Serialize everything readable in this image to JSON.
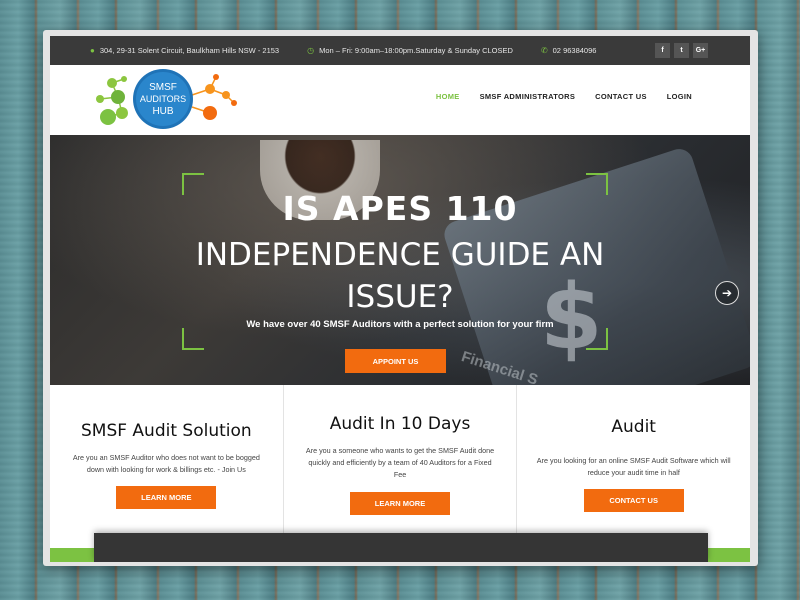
{
  "topbar": {
    "address": "304, 29-31 Solent Circuit, Baulkham Hills NSW - 2153",
    "hours": "Mon – Fri: 9:00am–18:00pm.Saturday & Sunday CLOSED",
    "phone": "02 96384096",
    "social": [
      "f",
      "t",
      "G+"
    ]
  },
  "logo": {
    "line1": "SMSF",
    "line2": "AUDITORS",
    "line3": "HUB"
  },
  "nav": {
    "items": [
      "HOME",
      "SMSF ADMINISTRATORS",
      "CONTACT US",
      "LOGIN"
    ]
  },
  "hero": {
    "title_line1": "IS APES 110",
    "title_line2": "INDEPENDENCE GUIDE AN",
    "title_line3": "ISSUE?",
    "subtitle": "We have over 40 SMSF Auditors with a perfect solution for your firm",
    "button": "APPOINT US",
    "bg_word": "Financial S",
    "bg_symbol": "$"
  },
  "features": [
    {
      "title": "SMSF Audit Solution",
      "text": "Are you an SMSF Auditor who does not want to be bogged down with looking for work & billings etc. - Join Us",
      "button": "LEARN MORE"
    },
    {
      "title": "Audit In 10 Days",
      "text": "Are you a someone who wants to get the SMSF Audit done quickly and efficiently by a team of 40 Auditors for a Fixed Fee",
      "button": "LEARN MORE"
    },
    {
      "title": "Audit",
      "text": "Are you looking for an online SMSF Audit Software which will reduce your audit time in half",
      "button": "CONTACT US"
    }
  ],
  "colors": {
    "accent_green": "#7cc242",
    "accent_orange": "#f26b0f",
    "topbar_bg": "#3a3a3a"
  }
}
